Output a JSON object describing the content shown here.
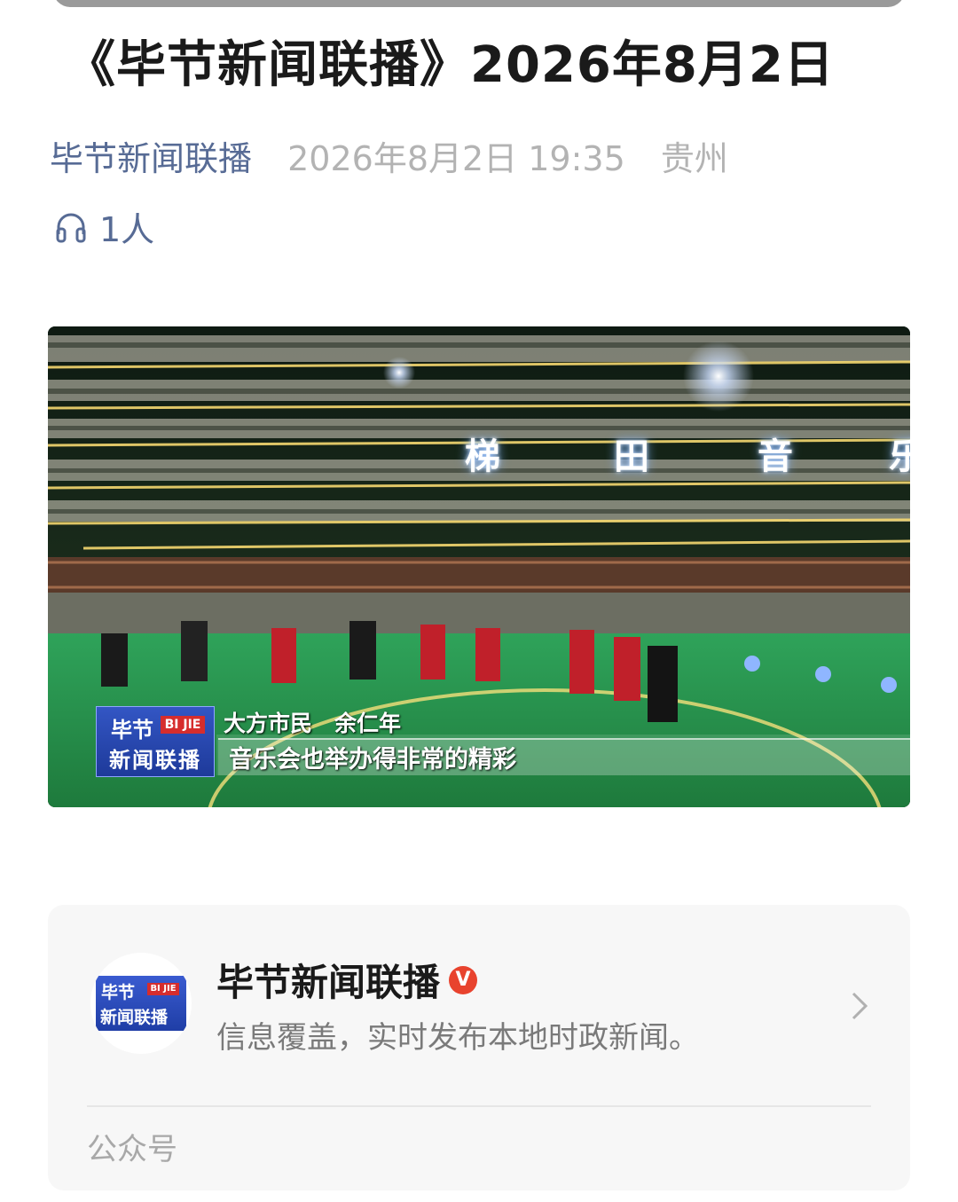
{
  "article": {
    "title": "《毕节新闻联播》2026年8月2日",
    "source": "毕节新闻联播",
    "date": "2026年8月2日 19:35",
    "region": "贵州",
    "listeners": "1人",
    "listen_icon": "headphones-icon"
  },
  "video": {
    "banner_chars": [
      "梯",
      "田",
      "音",
      "乐"
    ],
    "logo_line1": "毕节",
    "logo_tag": "BI JIE",
    "logo_line2": "新闻联播",
    "speaker": "大方市民　余仁年",
    "subtitle": "音乐会也举办得非常的精彩"
  },
  "account": {
    "name": "毕节新闻联播",
    "verified_icon": "verified-icon",
    "verified_mark": "V",
    "description": "信息覆盖，实时发布本地时政新闻。",
    "type": "公众号",
    "avatar_line1": "毕节",
    "avatar_tag": "BI JIE",
    "avatar_line2": "新闻联播"
  },
  "colors": {
    "link": "#576b95",
    "muted": "#b3b3b3",
    "card_bg": "#f7f7f7",
    "verified": "#e8432e",
    "logo_blue": "#2a4bb8"
  }
}
